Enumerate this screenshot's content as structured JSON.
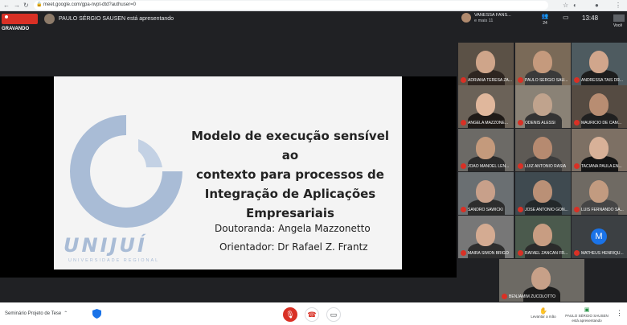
{
  "browser": {
    "url": "meet.google.com/gpa-nvpt-dtd?authuser=0",
    "nav": {
      "back": "←",
      "forward": "→",
      "reload": "↻"
    }
  },
  "topbar": {
    "recording_label": "GRAVANDO",
    "presenting_text": "PAULO SÉRGIO SAUSEN está apresentando",
    "speaker_name": "VANESSA FANS...",
    "speaker_more": "e mais 11",
    "people_count": "24",
    "time": "13:48",
    "you_label": "Você"
  },
  "slide": {
    "title_lines": [
      "Modelo de execução sensível ao",
      "contexto para processos de",
      "Integração de Aplicações",
      "Empresariais"
    ],
    "doutoranda": "Doutoranda: Angela Mazzonetto",
    "orientador": "Orientador: Dr Rafael Z. Frantz",
    "logo_text": "UNIJUÍ",
    "logo_sub": "UNIVERSIDADE REGIONAL"
  },
  "participants": [
    {
      "name": "ADRIANA TERESA ZA..."
    },
    {
      "name": "PAULO SÉRGIO SAU..."
    },
    {
      "name": "ANDRESSA TAIS DR..."
    },
    {
      "name": "ANGELA MAZZONE..."
    },
    {
      "name": "ODENIS ALESSI"
    },
    {
      "name": "MAURICIO DE CAM..."
    },
    {
      "name": "JOÃO MANOEL LEN..."
    },
    {
      "name": "LUIZ ANTÔNIO RASIA"
    },
    {
      "name": "TACIANA PAULA EN..."
    },
    {
      "name": "SANDRO SAWICKI"
    },
    {
      "name": "JOSÉ ANTONIO GON..."
    },
    {
      "name": "LUIS FERNANDO SA..."
    },
    {
      "name": "MAIRA SIMON BRIGO"
    },
    {
      "name": "RAFAEL ZANCAN FR..."
    },
    {
      "name": "MATHEUS HENRIQU...",
      "initial": "M"
    },
    {
      "name": "BENJAMIM ZUCOLOTTO"
    }
  ],
  "bottombar": {
    "meeting_name": "Seminário Projeto de Tese",
    "raise_hand": "Levantar a mão",
    "presenter_line1": "PAULO SÉRGIO SAUSEN",
    "presenter_line2": "está apresentando"
  },
  "colors": {
    "meet_dark": "#202124",
    "record_red": "#d93025",
    "logo_blue": "#a9bcd6",
    "avatar_blue": "#1a73e8"
  }
}
